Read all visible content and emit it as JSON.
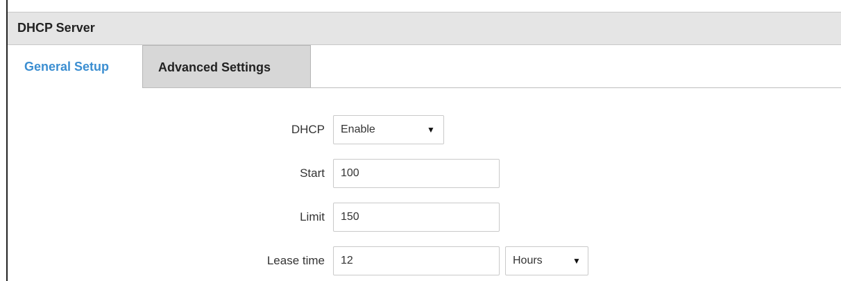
{
  "panel": {
    "title": "DHCP Server"
  },
  "tabs": [
    {
      "label": "General Setup",
      "active": true
    },
    {
      "label": "Advanced Settings",
      "active": false
    }
  ],
  "form": {
    "dhcp": {
      "label": "DHCP",
      "value": "Enable"
    },
    "start": {
      "label": "Start",
      "value": "100"
    },
    "limit": {
      "label": "Limit",
      "value": "150"
    },
    "lease_time": {
      "label": "Lease time",
      "value": "12",
      "unit": "Hours"
    }
  },
  "colors": {
    "active_tab": "#3b8ed1",
    "header_bg": "#e5e5e5",
    "inactive_tab_bg": "#d7d7d7"
  },
  "icons": {
    "dropdown_caret": "caret-down-icon"
  }
}
